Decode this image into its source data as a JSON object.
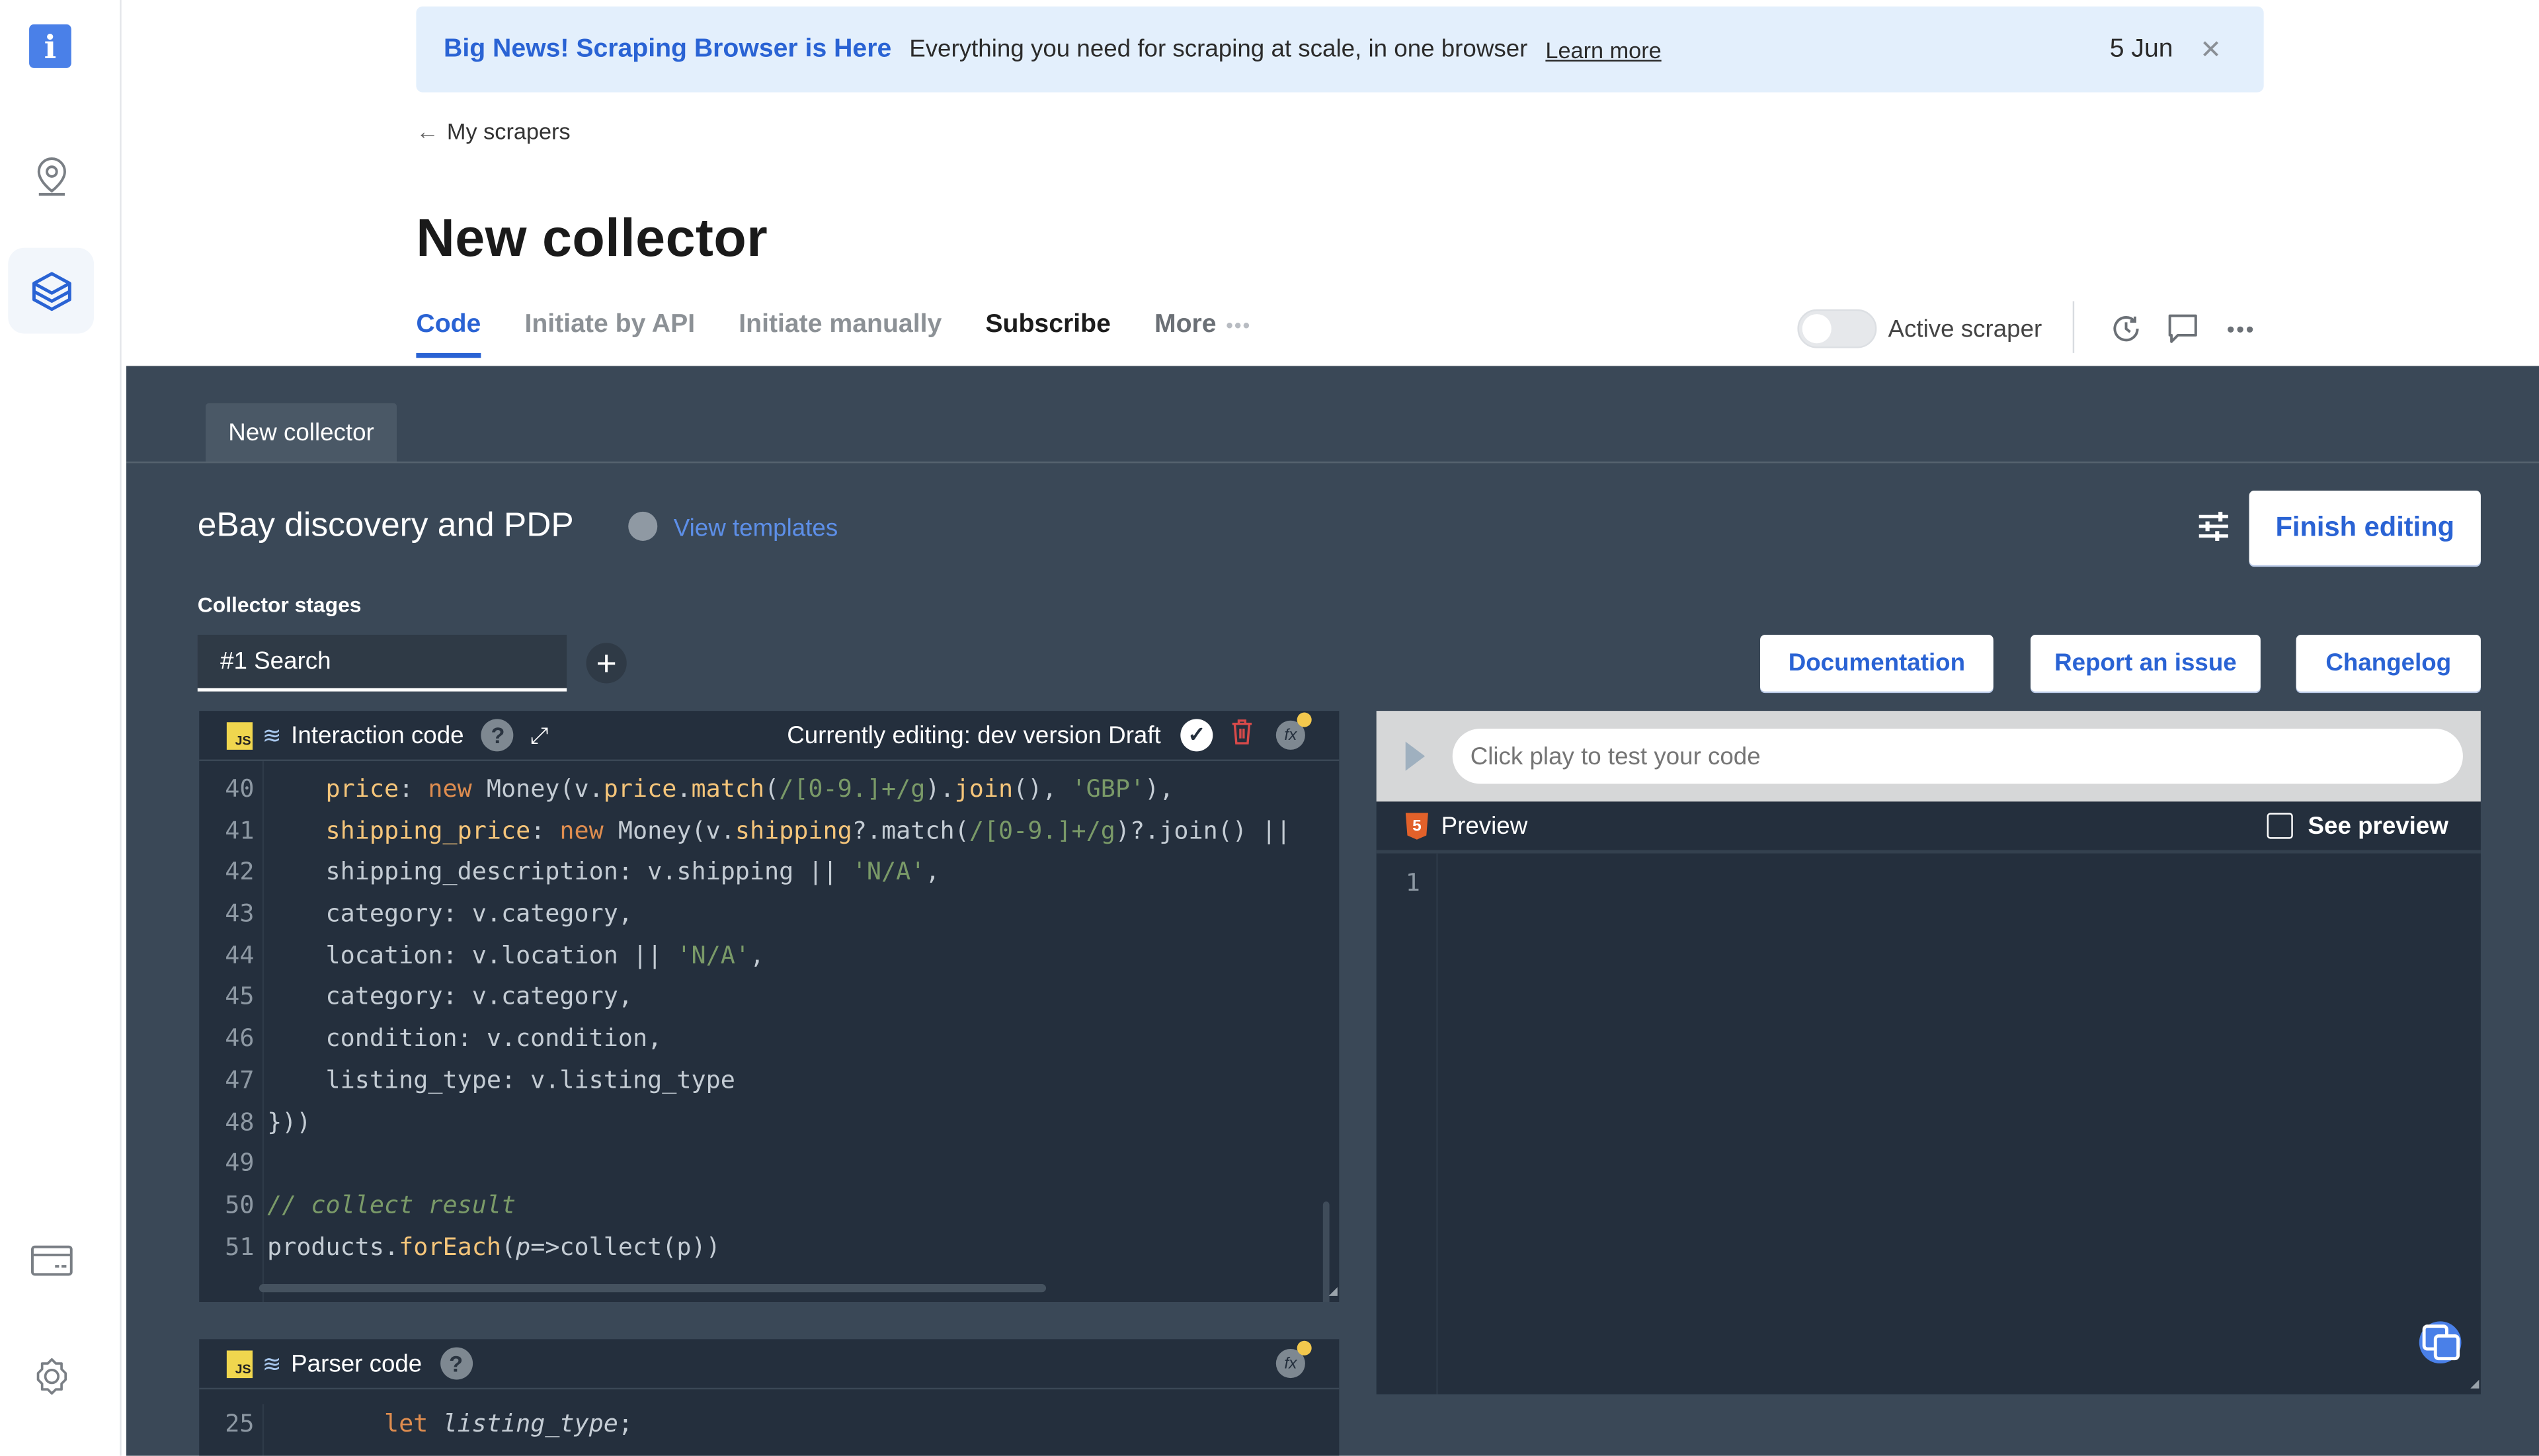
{
  "sidebar": {
    "logo_glyph": "i",
    "items": [
      {
        "name": "location-pin-icon"
      },
      {
        "name": "layers-icon",
        "active": true
      },
      {
        "name": "billing-card-icon"
      },
      {
        "name": "settings-gear-icon"
      }
    ]
  },
  "banner": {
    "title": "Big News! Scraping Browser is Here",
    "description": "Everything you need for scraping at scale, in one browser",
    "link": "Learn more",
    "date": "5 Jun",
    "close_glyph": "✕"
  },
  "breadcrumb": {
    "arrow": "←",
    "label": "My scrapers"
  },
  "page_title": "New collector",
  "tabs": [
    {
      "label": "Code",
      "active": true
    },
    {
      "label": "Initiate by API"
    },
    {
      "label": "Initiate manually"
    },
    {
      "label": "Subscribe"
    },
    {
      "label": "More",
      "dots": "•••"
    }
  ],
  "header_actions": {
    "active_scraper_label": "Active scraper",
    "active_scraper_on": false,
    "more_glyph": "•••"
  },
  "workspace": {
    "tab_label": "New collector",
    "collector_name": "eBay discovery and PDP",
    "view_templates": "View templates",
    "finish_editing": "Finish editing",
    "stages_label": "Collector stages",
    "stage_value": "#1  Search",
    "add_stage": "+",
    "buttons": {
      "documentation": "Documentation",
      "report_issue": "Report an issue",
      "changelog": "Changelog"
    }
  },
  "interaction_panel": {
    "js_badge": "JS",
    "title": "Interaction code",
    "help": "?",
    "expand": "⤢",
    "editing_status": "Currently editing: dev version Draft",
    "check": "✓",
    "trash": "🗑",
    "fx": "fx",
    "lines": [
      {
        "n": "40",
        "tokens": [
          [
            "",
            "    "
          ],
          [
            "k-yel",
            "price"
          ],
          [
            "",
            ": "
          ],
          [
            "k-org",
            "new"
          ],
          [
            "",
            " Money(v."
          ],
          [
            "k-yel",
            "price"
          ],
          [
            "",
            "."
          ],
          [
            "k-yel",
            "match"
          ],
          [
            "",
            "("
          ],
          [
            "k-str",
            "/[0-9.]+/g"
          ],
          [
            "",
            ")."
          ],
          [
            "k-yel",
            "join"
          ],
          [
            "",
            "(), "
          ],
          [
            "k-str",
            "'GBP'"
          ],
          [
            "",
            "),"
          ]
        ]
      },
      {
        "n": "41",
        "tokens": [
          [
            "",
            "    "
          ],
          [
            "k-yel",
            "shipping_price"
          ],
          [
            "",
            ": "
          ],
          [
            "k-org",
            "new"
          ],
          [
            "",
            " Money(v."
          ],
          [
            "k-yel",
            "shipping"
          ],
          [
            "",
            "?.match("
          ],
          [
            "k-str",
            "/[0-9.]+/g"
          ],
          [
            "",
            ")?.join() ||"
          ]
        ]
      },
      {
        "n": "42",
        "tokens": [
          [
            "",
            "    shipping_description: v.shipping || "
          ],
          [
            "k-str",
            "'N/A'"
          ],
          [
            "",
            ","
          ]
        ]
      },
      {
        "n": "43",
        "tokens": [
          [
            "",
            "    category: v.category,"
          ]
        ]
      },
      {
        "n": "44",
        "tokens": [
          [
            "",
            "    location: v.location || "
          ],
          [
            "k-str",
            "'N/A'"
          ],
          [
            "",
            ","
          ]
        ]
      },
      {
        "n": "45",
        "tokens": [
          [
            "",
            "    category: v.category,"
          ]
        ]
      },
      {
        "n": "46",
        "tokens": [
          [
            "",
            "    condition: v.condition,"
          ]
        ]
      },
      {
        "n": "47",
        "tokens": [
          [
            "",
            "    listing_type: v.listing_type"
          ]
        ]
      },
      {
        "n": "48",
        "tokens": [
          [
            "",
            "}))"
          ]
        ]
      },
      {
        "n": "49",
        "tokens": [
          [
            "",
            ""
          ]
        ]
      },
      {
        "n": "50",
        "tokens": [
          [
            "k-com",
            "// collect result"
          ]
        ]
      },
      {
        "n": "51",
        "tokens": [
          [
            "",
            "products."
          ],
          [
            "k-yel",
            "forEach"
          ],
          [
            "",
            "("
          ],
          [
            "k-it",
            "p"
          ],
          [
            "",
            "=>collect(p))"
          ]
        ]
      }
    ]
  },
  "parser_panel": {
    "js_badge": "JS",
    "title": "Parser code",
    "help": "?",
    "fx": "fx",
    "lines": [
      {
        "n": "25",
        "tokens": [
          [
            "",
            "        "
          ],
          [
            "k-org",
            "let"
          ],
          [
            "k-it",
            " listing_type"
          ],
          [
            "",
            ";"
          ]
        ]
      }
    ]
  },
  "preview_panel": {
    "run_placeholder": "Click play to test your code",
    "title": "Preview",
    "html5_badge": "5",
    "see_preview": "See preview",
    "line_number": "1"
  }
}
